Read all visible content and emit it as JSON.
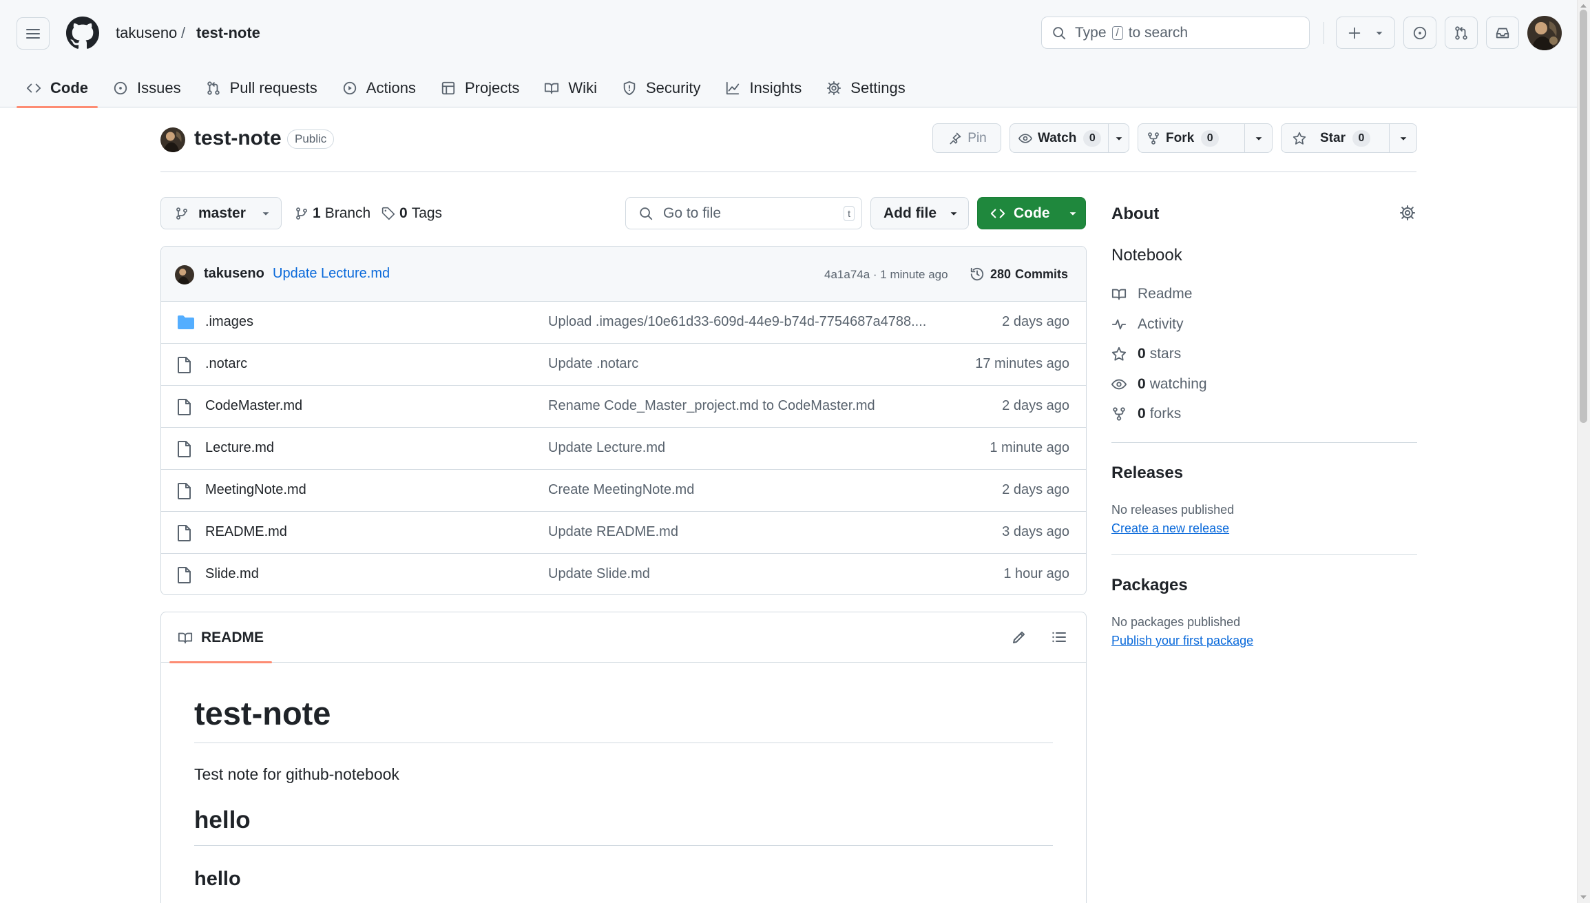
{
  "header": {
    "owner": "takuseno",
    "separator": "/",
    "repo": "test-note",
    "search_prefix": "Type",
    "search_key": "/",
    "search_suffix": "to search"
  },
  "tabs": [
    {
      "label": "Code",
      "icon": "code-icon",
      "active": true
    },
    {
      "label": "Issues",
      "icon": "issue-icon"
    },
    {
      "label": "Pull requests",
      "icon": "pull-request-icon"
    },
    {
      "label": "Actions",
      "icon": "play-icon"
    },
    {
      "label": "Projects",
      "icon": "table-icon"
    },
    {
      "label": "Wiki",
      "icon": "book-icon"
    },
    {
      "label": "Security",
      "icon": "shield-icon"
    },
    {
      "label": "Insights",
      "icon": "graph-icon"
    },
    {
      "label": "Settings",
      "icon": "gear-icon"
    }
  ],
  "repo": {
    "name": "test-note",
    "visibility": "Public",
    "pin_label": "Pin",
    "watch_label": "Watch",
    "watch_count": "0",
    "fork_label": "Fork",
    "fork_count": "0",
    "star_label": "Star",
    "star_count": "0"
  },
  "filenav": {
    "branch": "master",
    "branches_count": "1",
    "branches_label": "Branch",
    "tags_count": "0",
    "tags_label": "Tags",
    "goto_placeholder": "Go to file",
    "goto_key": "t",
    "add_file_label": "Add file",
    "code_label": "Code"
  },
  "latest_commit": {
    "author": "takuseno",
    "message": "Update Lecture.md",
    "meta": "4a1a74a · 1 minute ago",
    "commits_count": "280",
    "commits_label": "Commits"
  },
  "files": [
    {
      "name": ".images",
      "type": "folder",
      "message": "Upload .images/10e61d33-609d-44e9-b74d-7754687a4788....",
      "time": "2 days ago"
    },
    {
      "name": ".notarc",
      "type": "file",
      "message": "Update .notarc",
      "time": "17 minutes ago"
    },
    {
      "name": "CodeMaster.md",
      "type": "file",
      "message": "Rename Code_Master_project.md to CodeMaster.md",
      "time": "2 days ago"
    },
    {
      "name": "Lecture.md",
      "type": "file",
      "message": "Update Lecture.md",
      "time": "1 minute ago"
    },
    {
      "name": "MeetingNote.md",
      "type": "file",
      "message": "Create MeetingNote.md",
      "time": "2 days ago"
    },
    {
      "name": "README.md",
      "type": "file",
      "message": "Update README.md",
      "time": "3 days ago"
    },
    {
      "name": "Slide.md",
      "type": "file",
      "message": "Update Slide.md",
      "time": "1 hour ago"
    }
  ],
  "readme": {
    "tab_label": "README",
    "h1": "test-note",
    "paragraph": "Test note for github-notebook",
    "h2": "hello",
    "h3": "hello"
  },
  "about": {
    "title": "About",
    "description": "Notebook",
    "readme_label": "Readme",
    "activity_label": "Activity",
    "stars_count": "0",
    "stars_label": "stars",
    "watching_count": "0",
    "watching_label": "watching",
    "forks_count": "0",
    "forks_label": "forks"
  },
  "releases": {
    "title": "Releases",
    "note": "No releases published",
    "link": "Create a new release"
  },
  "packages": {
    "title": "Packages",
    "note": "No packages published",
    "link": "Publish your first package"
  },
  "colors": {
    "accent_green": "#1f883d",
    "link_blue": "#0969da",
    "tab_underline": "#fd8c73",
    "folder_blue": "#54aeff"
  }
}
